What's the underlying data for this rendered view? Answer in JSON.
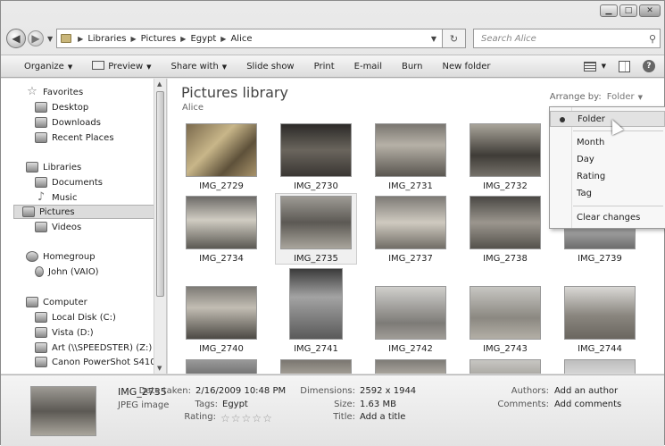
{
  "breadcrumb": [
    "Libraries",
    "Pictures",
    "Egypt",
    "Alice"
  ],
  "search": {
    "placeholder": "Search Alice"
  },
  "toolbar": {
    "organize": "Organize",
    "preview": "Preview",
    "share_with": "Share with",
    "slide_show": "Slide show",
    "print": "Print",
    "email": "E-mail",
    "burn": "Burn",
    "new_folder": "New folder"
  },
  "nav": {
    "favorites": "Favorites",
    "desktop": "Desktop",
    "downloads": "Downloads",
    "recent_places": "Recent Places",
    "libraries": "Libraries",
    "documents": "Documents",
    "music": "Music",
    "pictures": "Pictures",
    "videos": "Videos",
    "homegroup": "Homegroup",
    "john": "John (VAIO)",
    "computer": "Computer",
    "local_disk": "Local Disk (C:)",
    "vista": "Vista (D:)",
    "art": "Art (\\\\SPEEDSTER) (Z:)",
    "canon": "Canon PowerShot S410"
  },
  "library": {
    "title": "Pictures library",
    "subtitle": "Alice",
    "arrange_label": "Arrange by:",
    "arrange_value": "Folder"
  },
  "thumbnails": [
    "IMG_2729",
    "IMG_2730",
    "IMG_2731",
    "IMG_2732",
    "IMG_2734",
    "IMG_2735",
    "IMG_2737",
    "IMG_2738",
    "IMG_2739",
    "IMG_2740",
    "IMG_2741",
    "IMG_2742",
    "IMG_2743",
    "IMG_2744"
  ],
  "arrange_menu": {
    "folder": "Folder",
    "month": "Month",
    "day": "Day",
    "rating": "Rating",
    "tag": "Tag",
    "clear": "Clear changes"
  },
  "details": {
    "name": "IMG_2735",
    "type": "JPEG image",
    "date_label": "Date taken:",
    "date_value": "2/16/2009 10:48 PM",
    "tags_label": "Tags:",
    "tags_value": "Egypt",
    "rating_label": "Rating:",
    "dimensions_label": "Dimensions:",
    "dimensions_value": "2592 x 1944",
    "size_label": "Size:",
    "size_value": "1.63 MB",
    "title_label": "Title:",
    "title_value": "Add a title",
    "authors_label": "Authors:",
    "authors_value": "Add an author",
    "comments_label": "Comments:",
    "comments_value": "Add comments",
    "rating_stars": 0
  }
}
